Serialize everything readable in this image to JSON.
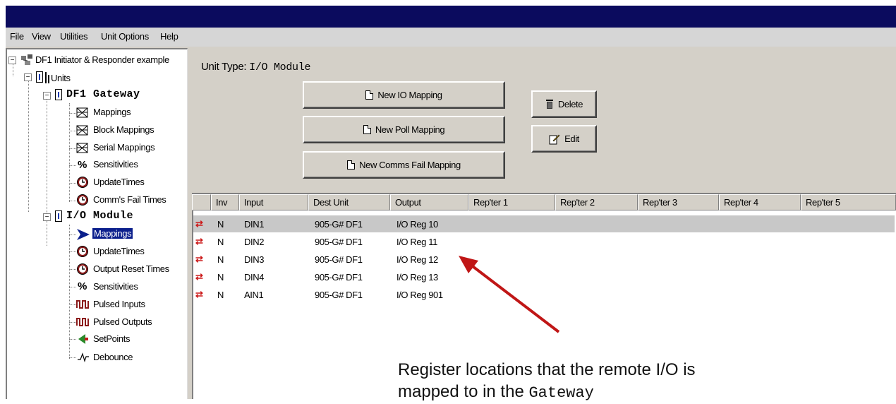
{
  "menu": [
    {
      "label": "File"
    },
    {
      "label": "View"
    },
    {
      "label": "Utilities"
    },
    {
      "label": "Unit Options"
    },
    {
      "label": "Help"
    }
  ],
  "tree": {
    "root": "DF1 Initiator & Responder example",
    "units": "Units",
    "gateway": {
      "label": "DF1 Gateway",
      "children": [
        "Mappings",
        "Block Mappings",
        "Serial Mappings",
        "Sensitivities",
        "UpdateTimes",
        "Comm's Fail Times"
      ]
    },
    "io": {
      "label": "I/O Module",
      "children": [
        "Mappings",
        "UpdateTimes",
        "Output Reset Times",
        "Sensitivities",
        "Pulsed Inputs",
        "Pulsed Outputs",
        "SetPoints",
        "Debounce"
      ]
    }
  },
  "unit_type": {
    "label": "Unit Type:",
    "value": "I/O Module"
  },
  "buttons": {
    "new_io": "New IO Mapping",
    "new_poll": "New Poll Mapping",
    "new_comms": "New Comms Fail Mapping",
    "delete": "Delete",
    "edit": "Edit"
  },
  "table": {
    "columns": [
      "Inv",
      "Input",
      "Dest Unit",
      "Output",
      "Rep'ter 1",
      "Rep'ter 2",
      "Rep'ter 3",
      "Rep'ter 4",
      "Rep'ter 5"
    ],
    "rows": [
      {
        "inv": "N",
        "input": "DIN1",
        "dest": "905-G# DF1",
        "output": "I/O Reg 10"
      },
      {
        "inv": "N",
        "input": "DIN2",
        "dest": "905-G# DF1",
        "output": "I/O Reg 11"
      },
      {
        "inv": "N",
        "input": "DIN3",
        "dest": "905-G# DF1",
        "output": "I/O Reg 12"
      },
      {
        "inv": "N",
        "input": "DIN4",
        "dest": "905-G# DF1",
        "output": "I/O Reg 13"
      },
      {
        "inv": "N",
        "input": "AIN1",
        "dest": "905-G# DF1",
        "output": "I/O Reg 901"
      }
    ]
  },
  "annotation": {
    "line1": "Register locations that the remote I/O is",
    "line2_a": "mapped to in the",
    "line2_b": "Gateway"
  },
  "colors": {
    "titlebar": "#0b0b5e",
    "selection": "#0b1f8c",
    "arrow": "#cc1b1b"
  }
}
